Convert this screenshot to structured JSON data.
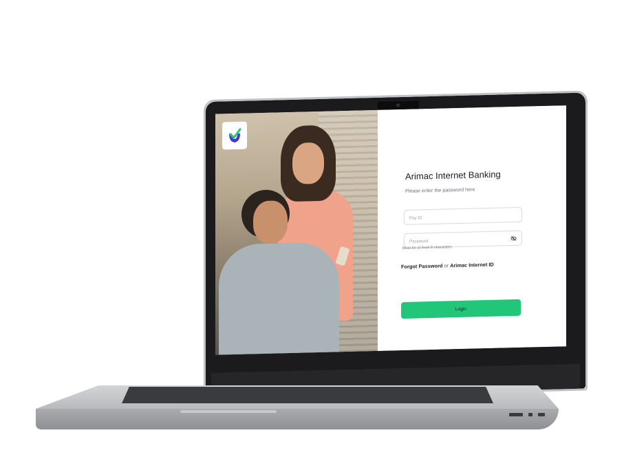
{
  "brand": {
    "accent_color": "#22c679",
    "logo_icon": "shield-check-logo-icon"
  },
  "login": {
    "title": "Arimac Internet Banking",
    "subtitle": "Please enter the password here",
    "pay_id_placeholder": "Pay ID",
    "password_placeholder": "Password",
    "password_hint": "Must be at least 8 characters",
    "forgot_password_label": "Forgot Password",
    "or_text": "or",
    "arimac_id_label": "Arimac Internet ID",
    "login_button_label": "Login",
    "visibility_icon": "eye-off-icon"
  }
}
